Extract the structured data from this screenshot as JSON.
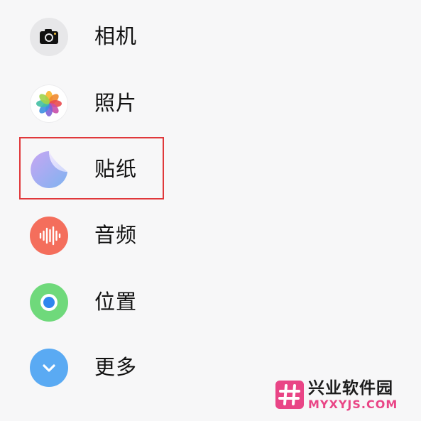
{
  "menu": {
    "items": [
      {
        "label": "相机",
        "icon": "camera-icon",
        "color": "#e7e7e9"
      },
      {
        "label": "照片",
        "icon": "photos-icon",
        "color": "#ffffff"
      },
      {
        "label": "贴纸",
        "icon": "sticker-icon",
        "color": "#a9a6f2"
      },
      {
        "label": "音频",
        "icon": "audio-waveform-icon",
        "color": "#f46e5c"
      },
      {
        "label": "位置",
        "icon": "location-icon",
        "color": "#6fd97b"
      },
      {
        "label": "更多",
        "icon": "chevron-down-icon",
        "color": "#5aaaf3"
      }
    ],
    "highlighted_item": "贴纸",
    "highlight_color": "#e0383b"
  },
  "watermark": {
    "name": "兴业软件园",
    "domain": "MYXYJS.COM",
    "brand_color": "#e94586"
  }
}
